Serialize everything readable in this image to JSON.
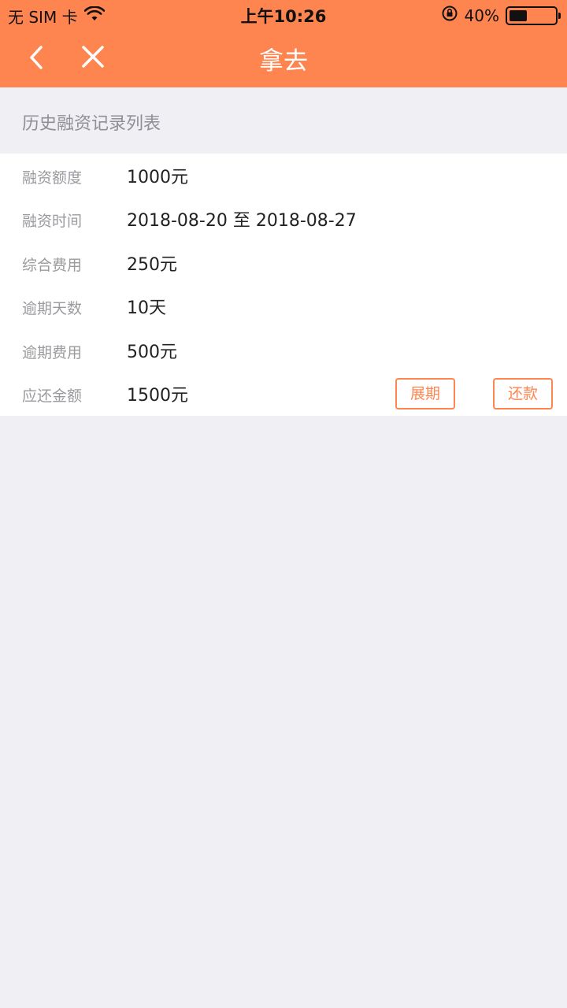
{
  "status_bar": {
    "carrier": "无 SIM 卡",
    "time": "上午10:26",
    "battery": "40%",
    "battery_level": 0.4
  },
  "nav": {
    "title": "拿去"
  },
  "section": {
    "title": "历史融资记录列表"
  },
  "record": {
    "rows": [
      {
        "label": "融资额度",
        "value": "1000元"
      },
      {
        "label": "融资时间",
        "value": "2018-08-20 至 2018-08-27"
      },
      {
        "label": "综合费用",
        "value": "250元"
      },
      {
        "label": "逾期天数",
        "value": "10天"
      },
      {
        "label": "逾期费用",
        "value": "500元"
      },
      {
        "label": "应还金额",
        "value": "1500元"
      }
    ],
    "extend_label": "展期",
    "repay_label": "还款"
  },
  "colors": {
    "accent": "#ff8550",
    "background": "#efeff4"
  }
}
